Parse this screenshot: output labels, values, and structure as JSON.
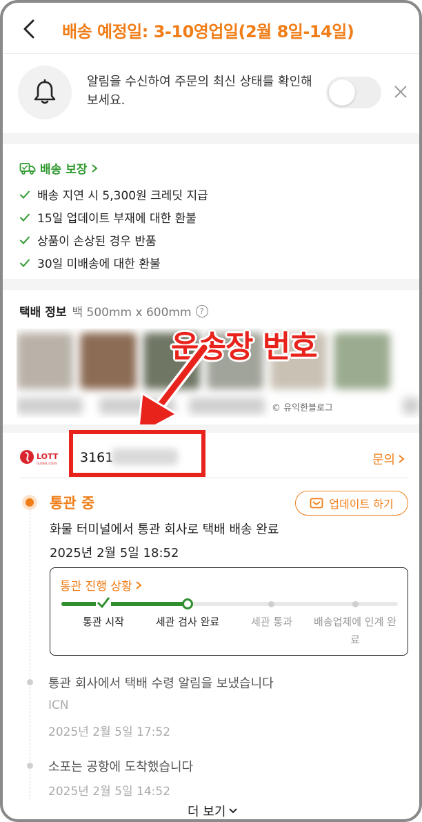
{
  "header": {
    "title": "배송 예정일: 3-10영업일(2월 8일-14일)"
  },
  "notification": {
    "text": "알림을 수신하여 주문의 최신 상태를 확인해 보세요.",
    "toggle_on": false
  },
  "guarantee": {
    "title": "배송 보장",
    "items": [
      "배송 지연 시 5,300원 크레딧 지급",
      "15일 업데이트 부재에 대한 환불",
      "상품이 손상된 경우 반품",
      "30일 미배송에 대한 환불"
    ],
    "color": "#2f9a2f"
  },
  "parcel": {
    "title": "택배 정보",
    "size": "백 500mm x 600mm",
    "help": "?",
    "watermark": "© 유익한블로그"
  },
  "annotation": {
    "text": "운송장  번호",
    "color": "#e8231c"
  },
  "carrier": {
    "logo_text": "LOTT",
    "logo_sub": "GLOBAL LOGIS",
    "tracking_prefix": "3161",
    "inquiry": "문의"
  },
  "current_status": {
    "title": "통관 중",
    "update_button": "업데이트 하기",
    "description": "화물 터미널에서 통관 회사로 택배 배송 완료",
    "time": "2025년 2월 5일 18:52"
  },
  "customs_progress": {
    "title": "통관 진행 상황",
    "steps": [
      "통관 시작",
      "세관 검사 완료",
      "세관 통과",
      "배송업체에 인계 완료"
    ],
    "completed_steps": 2,
    "accent": "#2f8f2f"
  },
  "events": [
    {
      "title": "통관 회사에서 택배 수령 알림을 보냈습니다",
      "location": "ICN",
      "time": "2025년 2월 5일 17:52"
    },
    {
      "title": "소포는 공항에 도착했습니다",
      "time": "2025년 2월 5일 14:52"
    }
  ],
  "more": {
    "label": "더 보기"
  },
  "colors": {
    "accent": "#f07d17",
    "annotation": "#e8231c"
  }
}
